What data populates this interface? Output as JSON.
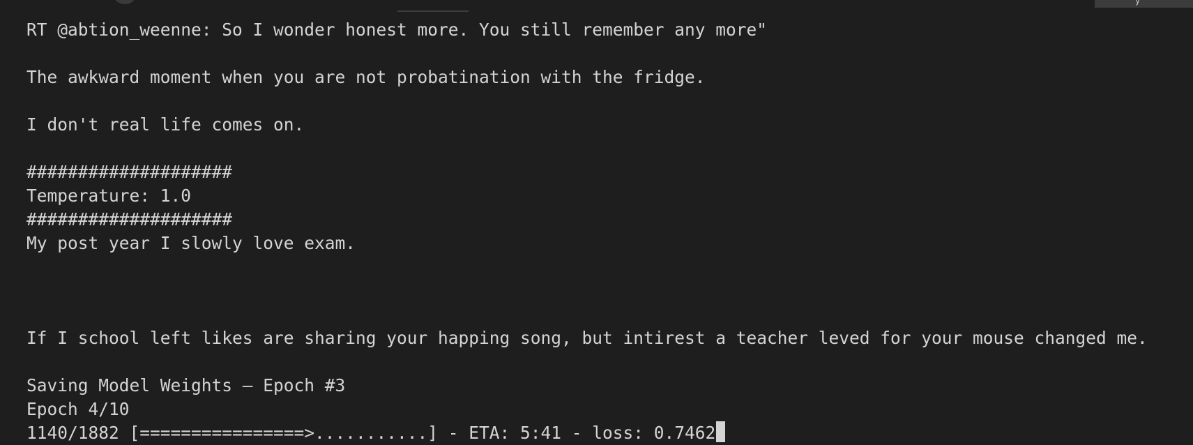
{
  "top_bar": {
    "right_tab_label": "y"
  },
  "terminal": {
    "lines": [
      "RT @abtion_weenne: So I wonder honest more. You still remember any more\"",
      "",
      "The awkward moment when you are not probatination with the fridge.",
      "",
      "I don't real life comes on.",
      "",
      "####################",
      "Temperature: 1.0",
      "####################",
      "My post year I slowly love exam.",
      "",
      "",
      "",
      "If I school left likes are sharing your happing song, but intirest a teacher leved for your mouse changed me.",
      "",
      "Saving Model Weights — Epoch #3",
      "Epoch 4/10",
      "1140/1882 [================>...........] - ETA: 5:41 - loss: 0.7462"
    ]
  }
}
